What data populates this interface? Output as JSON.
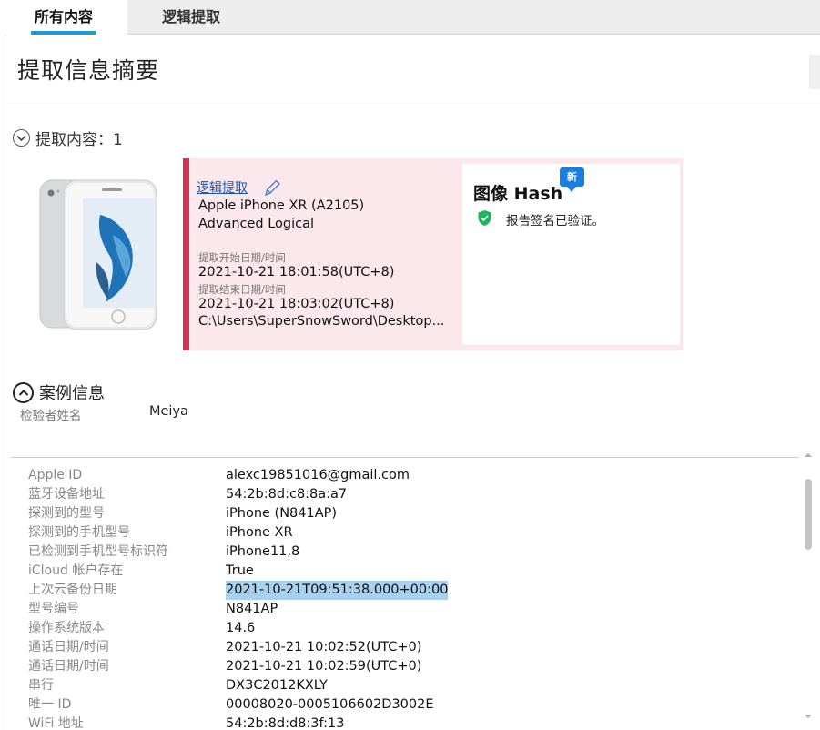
{
  "tabs": [
    {
      "label": "所有内容",
      "active": true
    },
    {
      "label": "逻辑提取",
      "active": false
    }
  ],
  "page_title": "提取信息摘要",
  "extraction_section": {
    "title": "提取内容：1",
    "icon": "chevron-down-circle-icon"
  },
  "card": {
    "link_label": "逻辑提取",
    "device_name": "Apple iPhone XR (A2105)",
    "extraction_type": "Advanced Logical",
    "start_label": "提取开始日期/时间",
    "start_value": "2021-10-21 18:01:58(UTC+8)",
    "end_label": "提取结束日期/时间",
    "end_value": "2021-10-21 18:03:02(UTC+8)",
    "path": "C:\\Users\\SuperSnowSword\\Desktop...",
    "accent_color": "#d23357",
    "background_color": "#fbe8ec"
  },
  "hash": {
    "title": "图像 Hash",
    "badge": "新",
    "status": "报告签名已验证。",
    "status_icon": "shield-check-icon",
    "status_color": "#1db45c"
  },
  "case_section": {
    "title": "案例信息",
    "icon": "chevron-up-circle-icon",
    "examiner_label": "检验者姓名",
    "examiner_value": "Meiya"
  },
  "details": [
    {
      "label": "Apple ID",
      "value": "alexc19851016@gmail.com"
    },
    {
      "label": "蓝牙设备地址",
      "value": "54:2b:8d:c8:8a:a7"
    },
    {
      "label": "探测到的型号",
      "value": "iPhone (N841AP)"
    },
    {
      "label": "探测到的手机型号",
      "value": "iPhone XR"
    },
    {
      "label": "已检测到手机型号标识符",
      "value": "iPhone11,8"
    },
    {
      "label": "iCloud 帐户存在",
      "value": "True"
    },
    {
      "label": "上次云备份日期",
      "value": "2021-10-21T09:51:38.000+00:00",
      "selected": true
    },
    {
      "label": "型号编号",
      "value": "N841AP"
    },
    {
      "label": "操作系统版本",
      "value": "14.6"
    },
    {
      "label": "通话日期/时间",
      "value": "2021-10-21 10:02:52(UTC+0)"
    },
    {
      "label": "通话日期/时间",
      "value": "2021-10-21 10:02:59(UTC+0)"
    },
    {
      "label": "串行",
      "value": "DX3C2012KXLY"
    },
    {
      "label": "唯一 ID",
      "value": "00008020-0005106602D3002E"
    },
    {
      "label": "WiFi 地址",
      "value": "54:2b:8d:d8:3f:13"
    }
  ],
  "colors": {
    "tab_accent": "#1f9ad6",
    "link": "#1a55b0",
    "selection": "#a8d1f0"
  }
}
